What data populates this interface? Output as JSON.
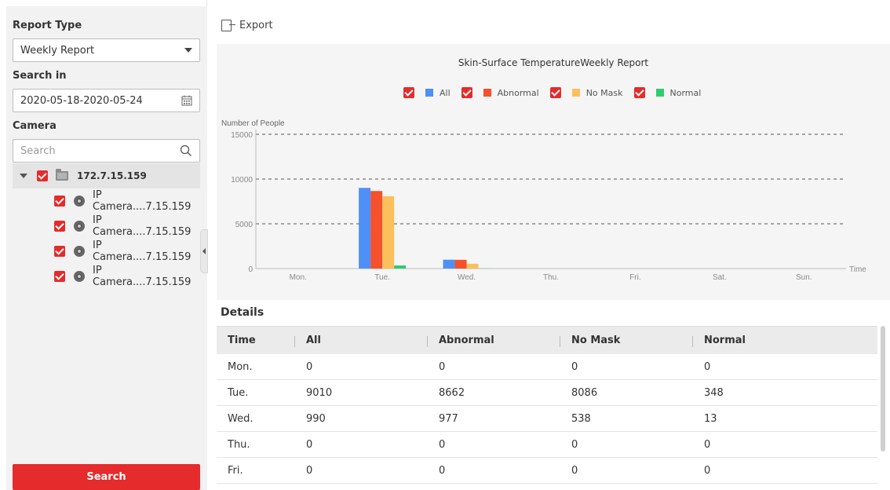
{
  "sidebar": {
    "report_type_label": "Report Type",
    "report_type_value": "Weekly Report",
    "search_in_label": "Search in",
    "date_range": "2020-05-18-2020-05-24",
    "camera_label": "Camera",
    "camera_search_placeholder": "Search",
    "tree_root": "172.7.15.159",
    "cameras": [
      "IP Camera....7.15.159",
      "IP Camera....7.15.159",
      "IP Camera....7.15.159",
      "IP Camera....7.15.159"
    ],
    "search_button": "Search"
  },
  "toolbar": {
    "export_label": "Export"
  },
  "chart_data": {
    "type": "bar",
    "title": "Skin-Surface TemperatureWeekly Report",
    "ylabel": "Number of People",
    "xlabel": "Time",
    "ylim": [
      0,
      15000
    ],
    "yticks": [
      0,
      5000,
      10000,
      15000
    ],
    "grid": true,
    "legend_position": "top-center",
    "categories": [
      "Mon.",
      "Tue.",
      "Wed.",
      "Thu.",
      "Fri.",
      "Sat.",
      "Sun."
    ],
    "series": [
      {
        "name": "All",
        "color": "#4f8ff7",
        "values": [
          0,
          9010,
          990,
          0,
          0,
          0,
          0
        ]
      },
      {
        "name": "Abnormal",
        "color": "#f4512c",
        "values": [
          0,
          8662,
          977,
          0,
          0,
          0,
          0
        ]
      },
      {
        "name": "No Mask",
        "color": "#fbbf5c",
        "values": [
          0,
          8086,
          538,
          0,
          0,
          0,
          0
        ]
      },
      {
        "name": "Normal",
        "color": "#2ecc71",
        "values": [
          0,
          348,
          13,
          0,
          0,
          0,
          0
        ]
      }
    ]
  },
  "details": {
    "title": "Details",
    "columns": [
      "Time",
      "All",
      "Abnormal",
      "No Mask",
      "Normal"
    ],
    "rows": [
      [
        "Mon.",
        "0",
        "0",
        "0",
        "0"
      ],
      [
        "Tue.",
        "9010",
        "8662",
        "8086",
        "348"
      ],
      [
        "Wed.",
        "990",
        "977",
        "538",
        "13"
      ],
      [
        "Thu.",
        "0",
        "0",
        "0",
        "0"
      ],
      [
        "Fri.",
        "0",
        "0",
        "0",
        "0"
      ]
    ]
  }
}
